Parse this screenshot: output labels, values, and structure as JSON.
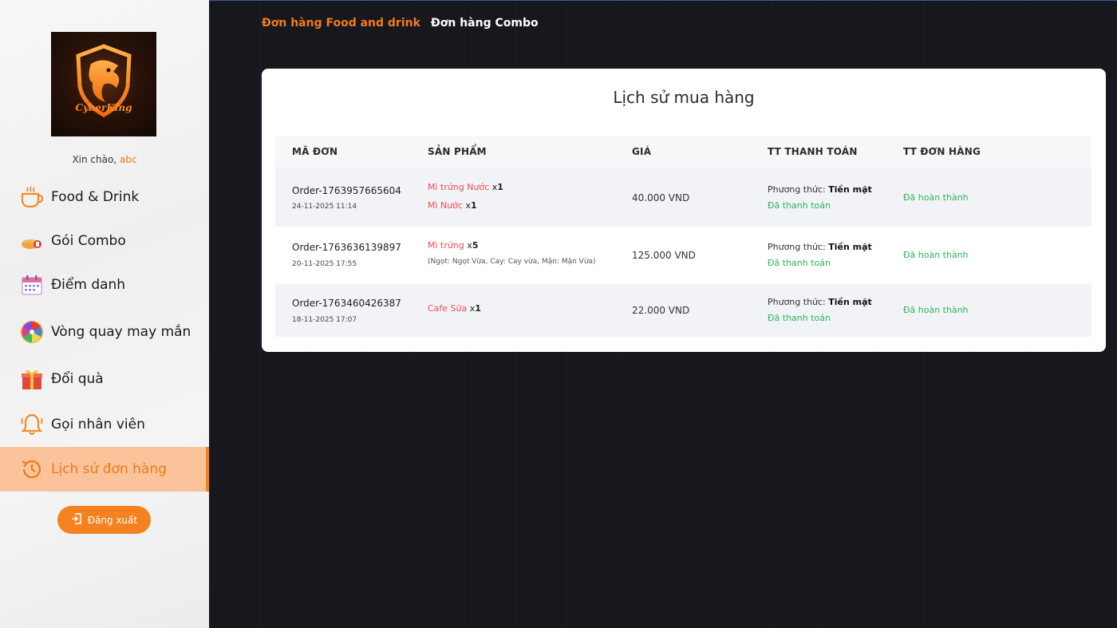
{
  "brand": {
    "logo_text": "CyberKing"
  },
  "greeting": {
    "prefix": "Xin chào,",
    "username": "abc"
  },
  "sidebar": {
    "items": [
      {
        "label": "Food & Drink",
        "icon": "coffee-cup-icon"
      },
      {
        "label": "Gói Combo",
        "icon": "combo-food-icon"
      },
      {
        "label": "Điểm danh",
        "icon": "calendar-icon"
      },
      {
        "label": "Vòng quay may mắn",
        "icon": "lucky-wheel-icon"
      },
      {
        "label": "Đổi quà",
        "icon": "gift-icon"
      },
      {
        "label": "Gọi nhân viên",
        "icon": "bell-icon"
      },
      {
        "label": "Lịch sử đơn hàng",
        "icon": "history-icon",
        "active": true
      }
    ],
    "logout_label": "Đăng xuất"
  },
  "tabs": [
    {
      "label": "Đơn hàng Food and drink",
      "active": true
    },
    {
      "label": "Đơn hàng Combo",
      "active": false
    }
  ],
  "history": {
    "title": "Lịch sử mua hàng",
    "columns": [
      "MÃ ĐƠN",
      "SẢN PHẨM",
      "GIÁ",
      "TT THANH TOÁN",
      "TT ĐƠN HÀNG"
    ],
    "rows": [
      {
        "order_id": "Order-1763957665604",
        "date": "24-11-2025 11:14",
        "products": [
          {
            "name": "Mì trứng Nước",
            "qty_prefix": "x",
            "qty": "1"
          },
          {
            "name": "Mì Nước",
            "qty_prefix": "x",
            "qty": "1"
          }
        ],
        "options": "",
        "price": "40.000 VND",
        "method_label": "Phương thức:",
        "method": "Tiền mặt",
        "payment_status": "Đã thanh toán",
        "order_status": "Đã hoàn thành"
      },
      {
        "order_id": "Order-1763636139897",
        "date": "20-11-2025 17:55",
        "products": [
          {
            "name": "Mì trứng",
            "qty_prefix": "x",
            "qty": "5"
          }
        ],
        "options": "(Ngọt: Ngọt Vừa, Cay: Cay vừa, Mặn: Mặn Vừa)",
        "price": "125.000 VND",
        "method_label": "Phương thức:",
        "method": "Tiền mặt",
        "payment_status": "Đã thanh toán",
        "order_status": "Đã hoàn thành"
      },
      {
        "order_id": "Order-1763460426387",
        "date": "18-11-2025 17:07",
        "products": [
          {
            "name": "Cafe Sữa",
            "qty_prefix": "x",
            "qty": "1"
          }
        ],
        "options": "",
        "price": "22.000 VND",
        "method_label": "Phương thức:",
        "method": "Tiền mặt",
        "payment_status": "Đã thanh toán",
        "order_status": "Đã hoàn thành"
      }
    ]
  },
  "colors": {
    "accent": "#f58220",
    "paid_green": "#2cb55a",
    "product_red": "#ef4f4f"
  }
}
